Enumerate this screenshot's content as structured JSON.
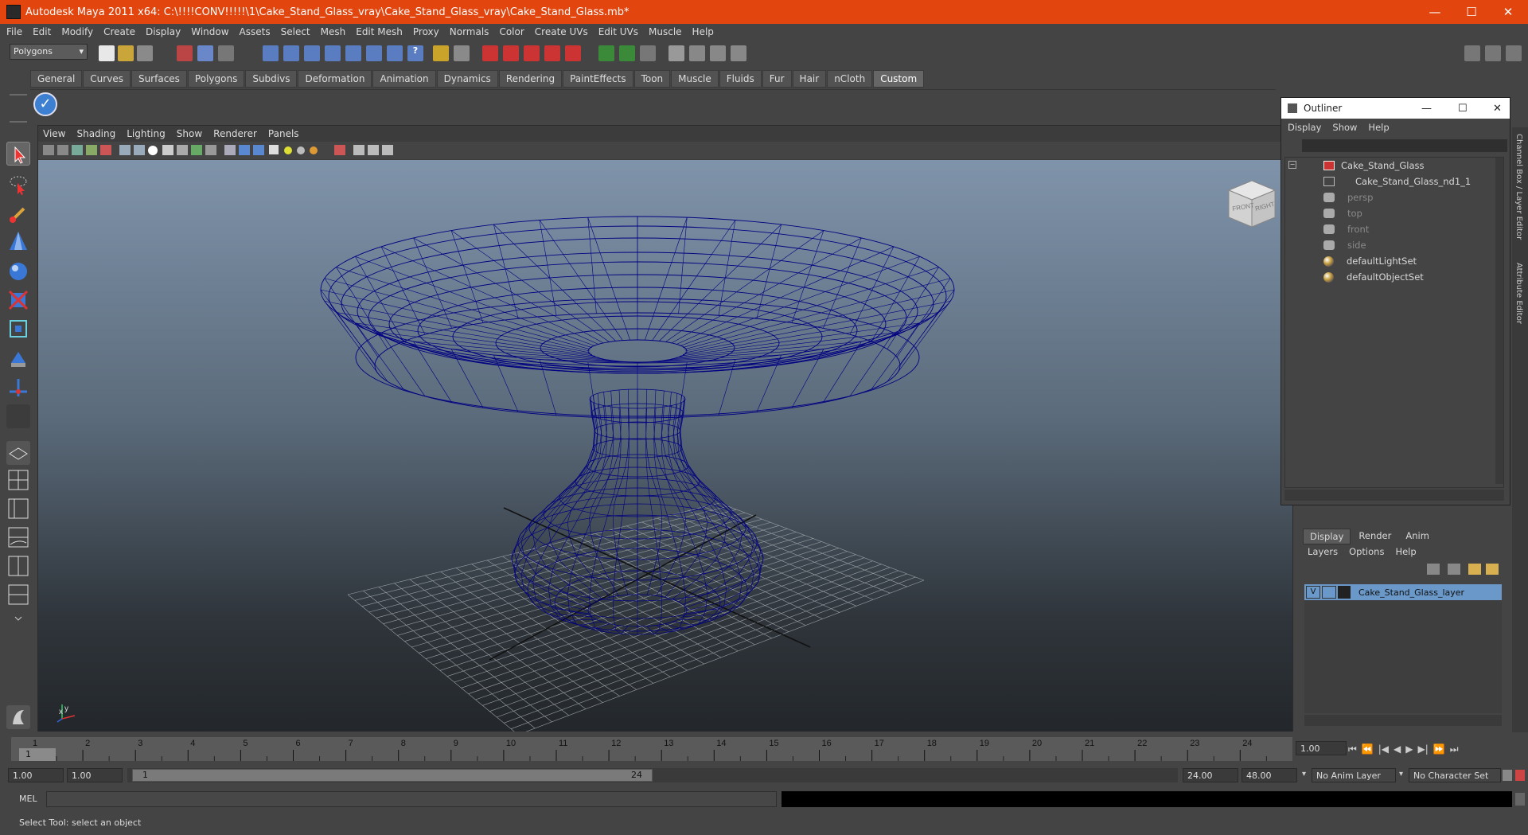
{
  "window": {
    "title": "Autodesk Maya 2011 x64: C:\\!!!!CONV!!!!!\\1\\Cake_Stand_Glass_vray\\Cake_Stand_Glass_vray\\Cake_Stand_Glass.mb*",
    "minimize": "—",
    "maximize": "☐",
    "close": "✕"
  },
  "menubar": [
    "File",
    "Edit",
    "Modify",
    "Create",
    "Display",
    "Window",
    "Assets",
    "Select",
    "Mesh",
    "Edit Mesh",
    "Proxy",
    "Normals",
    "Color",
    "Create UVs",
    "Edit UVs",
    "Muscle",
    "Help"
  ],
  "mode_dropdown": "Polygons",
  "shelf_tabs": [
    "General",
    "Curves",
    "Surfaces",
    "Polygons",
    "Subdivs",
    "Deformation",
    "Animation",
    "Dynamics",
    "Rendering",
    "PaintEffects",
    "Toon",
    "Muscle",
    "Fluids",
    "Fur",
    "Hair",
    "nCloth",
    "Custom"
  ],
  "active_shelf_tab": "Custom",
  "panel_menu": [
    "View",
    "Shading",
    "Lighting",
    "Show",
    "Renderer",
    "Panels"
  ],
  "viewcube": {
    "front": "FRONT",
    "right": "RIGHT"
  },
  "axis": {
    "x": "x",
    "y": "y"
  },
  "outliner": {
    "title": "Outliner",
    "menu": [
      "Display",
      "Show",
      "Help"
    ],
    "items": [
      {
        "label": "Cake_Stand_Glass",
        "dim": false
      },
      {
        "label": "Cake_Stand_Glass_nd1_1",
        "dim": false
      },
      {
        "label": "persp",
        "dim": true
      },
      {
        "label": "top",
        "dim": true
      },
      {
        "label": "front",
        "dim": true
      },
      {
        "label": "side",
        "dim": true
      },
      {
        "label": "defaultLightSet",
        "dim": false
      },
      {
        "label": "defaultObjectSet",
        "dim": false
      }
    ]
  },
  "side_tabs": {
    "channel_box": "Channel Box / Layer Editor",
    "attribute_editor": "Attribute Editor"
  },
  "layer_editor": {
    "tabs": [
      "Display",
      "Render",
      "Anim"
    ],
    "menu": [
      "Layers",
      "Options",
      "Help"
    ],
    "visible_flag": "V",
    "layer_name": "Cake_Stand_Glass_layer"
  },
  "timeline": {
    "ticks": [
      "1",
      "2",
      "3",
      "4",
      "5",
      "6",
      "7",
      "8",
      "9",
      "10",
      "11",
      "12",
      "13",
      "14",
      "15",
      "16",
      "17",
      "18",
      "19",
      "20",
      "21",
      "22",
      "23",
      "24"
    ],
    "current_frame_marker": "1",
    "current_time": "1.00"
  },
  "range": {
    "start": "1.00",
    "playback_start": "1.00",
    "slider_start": "1",
    "slider_end": "24",
    "playback_end": "24.00",
    "end": "48.00",
    "anim_layer": "No Anim Layer",
    "character_set": "No Character Set"
  },
  "command_line": {
    "label": "MEL"
  },
  "help_line": "Select Tool: select an object",
  "colors": {
    "titlebar": "#e2450e",
    "wireframe": "#000080",
    "layer_highlight": "#6a98c8"
  }
}
